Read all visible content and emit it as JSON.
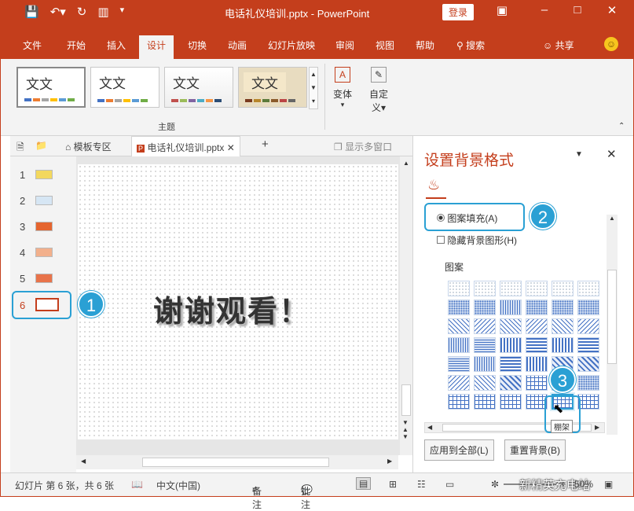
{
  "titlebar": {
    "title": "电话礼仪培训.pptx  -  PowerPoint",
    "login_label": "登录"
  },
  "tabs": [
    "文件",
    "开始",
    "插入",
    "设计",
    "切换",
    "动画",
    "幻灯片放映",
    "审阅",
    "视图",
    "帮助"
  ],
  "search_label": "搜索",
  "share_label": "共享",
  "ribbon": {
    "theme_text": "文文",
    "group_label": "主题",
    "variant_label": "变体",
    "customize_label_1": "自定",
    "customize_label_2": "义"
  },
  "doctabs": {
    "template_label": "模板专区",
    "file_label": "电话礼仪培训.pptx",
    "multiwin_label": "显示多窗口"
  },
  "thumbnails": [
    "1",
    "2",
    "3",
    "4",
    "5",
    "6"
  ],
  "slide": {
    "text": "谢谢观看！"
  },
  "pane": {
    "title": "设置背景格式",
    "pattern_fill": "图案填充(A)",
    "hide_bg": "隐藏背景图形(H)",
    "pattern_label": "图案",
    "tooltip": "棚架",
    "apply_all": "应用到全部(L)",
    "reset": "重置背景(B)"
  },
  "callouts": [
    "1",
    "2",
    "3"
  ],
  "statusbar": {
    "slide_info": "幻灯片 第 6 张，共 6 张",
    "language": "中文(中国)",
    "notes": "备注",
    "comments": "批注",
    "zoom": "50%",
    "watermark": "新精英充电站"
  },
  "colors": {
    "accent": "#c43e1c",
    "callout": "#2aa0d4"
  }
}
